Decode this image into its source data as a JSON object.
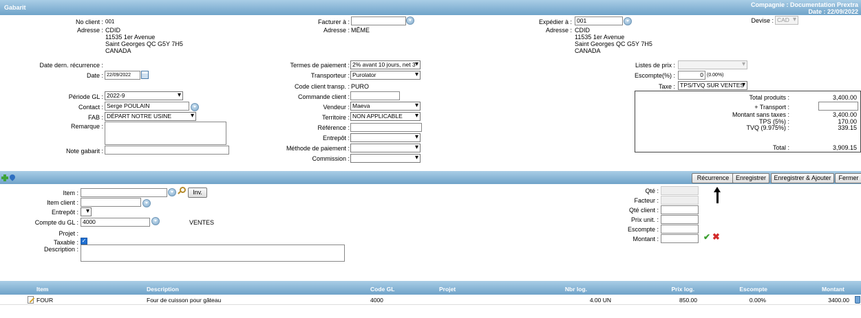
{
  "header": {
    "title": "Gabarit",
    "company": "Compagnie : Documentation Prextra",
    "date": "Date : 22/09/2022"
  },
  "client": {
    "no_label": "No client :",
    "no_value": "001",
    "address_label": "Adresse :",
    "address_lines": [
      "CDID",
      "11535 1er Avenue",
      "Saint Georges QC G5Y 7H5",
      "CANADA"
    ]
  },
  "billing": {
    "bill_to_label": "Facturer à :",
    "bill_to_value": "",
    "address_label": "Adresse :",
    "address_value": "MÊME"
  },
  "shipping": {
    "ship_from_label": "Expédier à :",
    "ship_from_value": "001",
    "address_label": "Adresse :",
    "address_lines": [
      "CDID",
      "11535 1er Avenue",
      "Saint Georges QC G5Y 7H5",
      "CANADA"
    ]
  },
  "currency": {
    "label": "Devise :",
    "value": "CAD"
  },
  "left_fields": {
    "recurrence_label": "Date dern. récurrence :",
    "date_label": "Date :",
    "date_value": "22/09/2022",
    "period_label": "Période GL :",
    "period_value": "2022-9",
    "contact_label": "Contact :",
    "contact_value": "Serge POULAIN",
    "fab_label": "FAB :",
    "fab_value": "DÉPART NOTRE USINE",
    "remark_label": "Remarque :",
    "note_label": "Note gabarit :"
  },
  "middle_fields": {
    "terms_label": "Termes de paiement :",
    "terms_value": "2% avant 10 jours, net 3",
    "carrier_label": "Transporteur :",
    "carrier_value": "Purolator",
    "carrier_code_label": "Code client transp. :",
    "carrier_code_value": "PURO",
    "order_label": "Commande client :",
    "seller_label": "Vendeur :",
    "seller_value": "Maeva",
    "territory_label": "Territoire :",
    "territory_value": "NON APPLICABLE",
    "reference_label": "Référence :",
    "warehouse_label": "Entrepôt :",
    "payment_method_label": "Méthode de paiement :",
    "commission_label": "Commission :"
  },
  "right_fields": {
    "price_list_label": "Listes de prix :",
    "discount_label": "Escompte(%) :",
    "discount_value": "0",
    "discount_pct": "(0.00%)",
    "tax_label": "Taxe :",
    "tax_value": "TPS/TVQ SUR VENTES"
  },
  "totals": {
    "products_label": "Total produits :",
    "products_value": "3,400.00",
    "transport_label": "+ Transport :",
    "pretax_label": "Montant sans taxes :",
    "pretax_value": "3,400.00",
    "tps_label": "TPS (5%) :",
    "tps_value": "170.00",
    "tvq_label": "TVQ (9.975%) :",
    "tvq_value": "339.15",
    "total_label": "Total :",
    "total_value": "3,909.15"
  },
  "toolbar": {
    "recurrence": "Récurrence",
    "save": "Enregistrer",
    "save_add": "Enregistrer & Ajouter",
    "close": "Fermer"
  },
  "item_form": {
    "item_label": "Item :",
    "inv_button": "Inv.",
    "client_item_label": "Item client :",
    "warehouse_label": "Entrepôt :",
    "gl_label": "Compte du GL :",
    "gl_value": "4000",
    "gl_desc": "VENTES",
    "project_label": "Projet :",
    "taxable_label": "Taxable :",
    "description_label": "Description :",
    "qty_label": "Qté :",
    "factor_label": "Facteur :",
    "client_qty_label": "Qté client :",
    "unit_price_label": "Prix unit. :",
    "discount_label": "Escompte :",
    "amount_label": "Montant :"
  },
  "grid": {
    "columns": [
      "Item",
      "Description",
      "Code GL",
      "Projet",
      "Nbr log.",
      "Prix log.",
      "Escompte",
      "Montant"
    ],
    "rows": [
      {
        "item": "FOUR",
        "description": "Four de cuisson pour gâteau",
        "gl": "4000",
        "project": "",
        "qty": "4.00 UN",
        "price": "850.00",
        "discount": "0.00%",
        "amount": "3400.00"
      }
    ]
  },
  "icons": [
    "dropdown-circle-icon",
    "calendar-icon",
    "search-icon",
    "add-icon",
    "pin-icon",
    "checkmark-icon",
    "cancel-icon",
    "edit-icon",
    "trash-icon",
    "arrow-up-icon"
  ]
}
